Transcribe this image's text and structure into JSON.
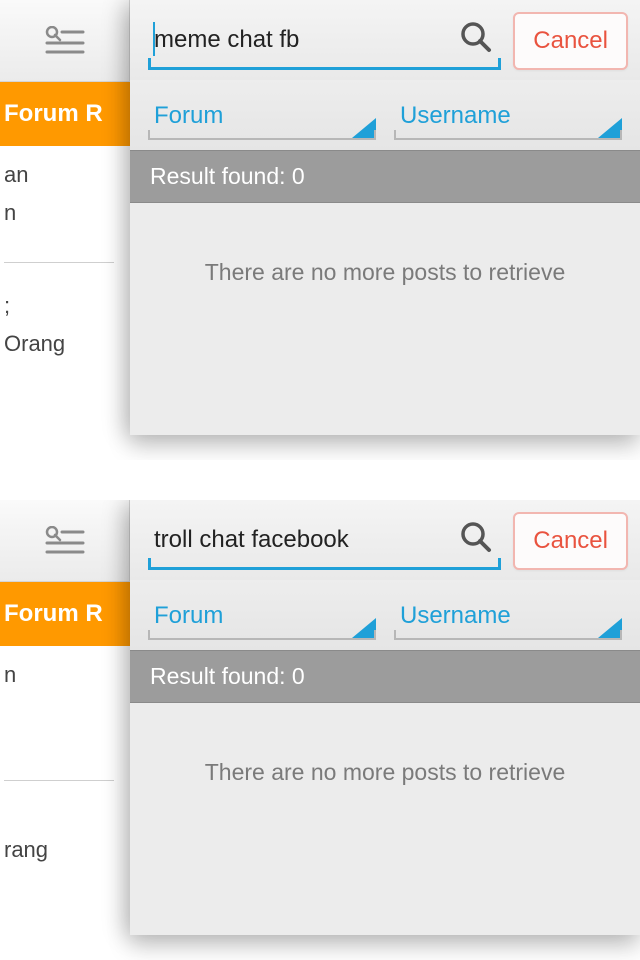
{
  "panes": [
    {
      "search_value": "meme chat fb",
      "show_caret": true,
      "cancel_label": "Cancel",
      "filter_forum_label": "Forum",
      "filter_user_label": "Username",
      "result_bar": "Result found: 0",
      "empty_msg": "There are no more posts to retrieve",
      "bg_tab": "Forum R",
      "bg_items": [
        "an",
        "n"
      ],
      "bg_items2": [
        ";",
        "Orang"
      ]
    },
    {
      "search_value": "troll chat facebook",
      "show_caret": false,
      "cancel_label": "Cancel",
      "filter_forum_label": "Forum",
      "filter_user_label": "Username",
      "result_bar": "Result found: 0",
      "empty_msg": "There are no more posts to retrieve",
      "bg_tab": "Forum R",
      "bg_items": [
        "n"
      ],
      "bg_items2": [
        "rang"
      ]
    }
  ]
}
